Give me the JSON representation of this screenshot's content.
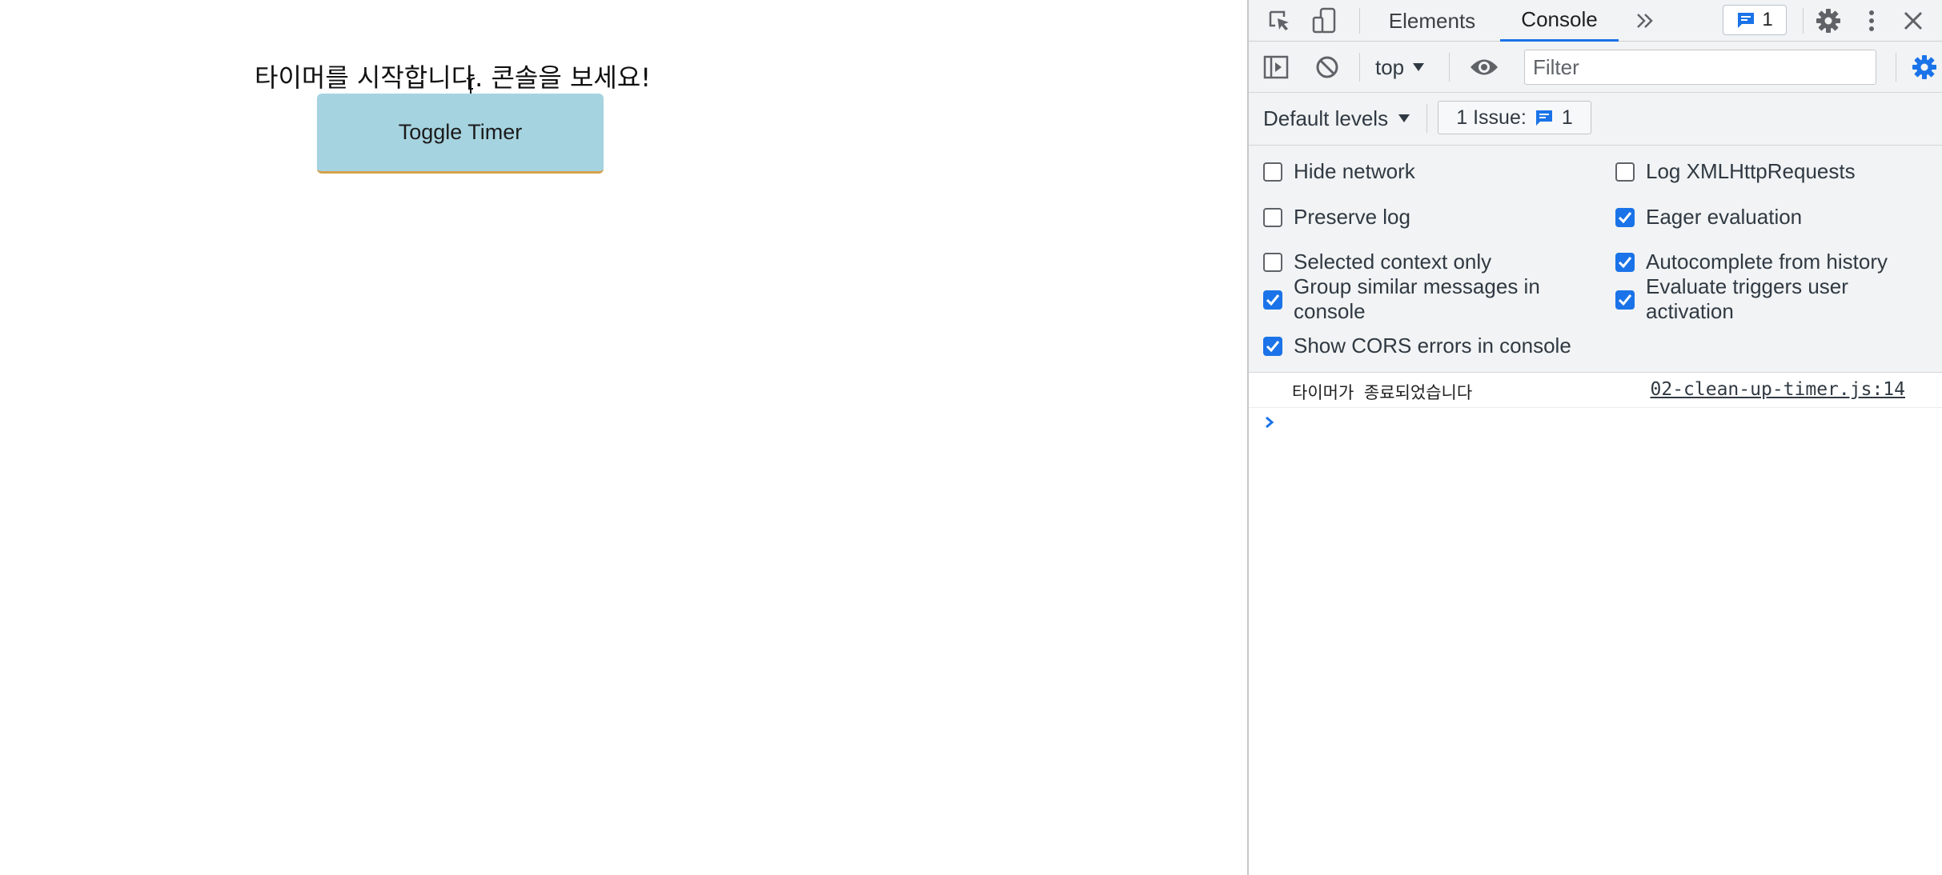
{
  "page": {
    "heading": "타이머를 시작합니다. 콘솔을 보세요!",
    "button_label": "Toggle Timer"
  },
  "devtools": {
    "tabs": [
      {
        "label": "Elements",
        "active": false
      },
      {
        "label": "Console",
        "active": true
      }
    ],
    "issues_count": "1",
    "context": "top",
    "filter_placeholder": "Filter",
    "levels_label": "Default levels",
    "issue_button_label": "1 Issue:",
    "issue_button_count": "1",
    "settings": {
      "left": [
        {
          "label": "Hide network",
          "checked": false
        },
        {
          "label": "Preserve log",
          "checked": false
        },
        {
          "label": "Selected context only",
          "checked": false
        },
        {
          "label": "Group similar messages in console",
          "checked": true
        },
        {
          "label": "Show CORS errors in console",
          "checked": true
        }
      ],
      "right": [
        {
          "label": "Log XMLHttpRequests",
          "checked": false
        },
        {
          "label": "Eager evaluation",
          "checked": true
        },
        {
          "label": "Autocomplete from history",
          "checked": true
        },
        {
          "label": "Evaluate triggers user activation",
          "checked": true
        }
      ]
    },
    "console_messages": [
      {
        "text": "타이머가 종료되었습니다",
        "source": "02-clean-up-timer.js:14"
      }
    ],
    "colors": {
      "accent": "#1a73e8",
      "button_bg": "#a6d3e0",
      "toolbar_bg": "#f1f3f4"
    }
  }
}
